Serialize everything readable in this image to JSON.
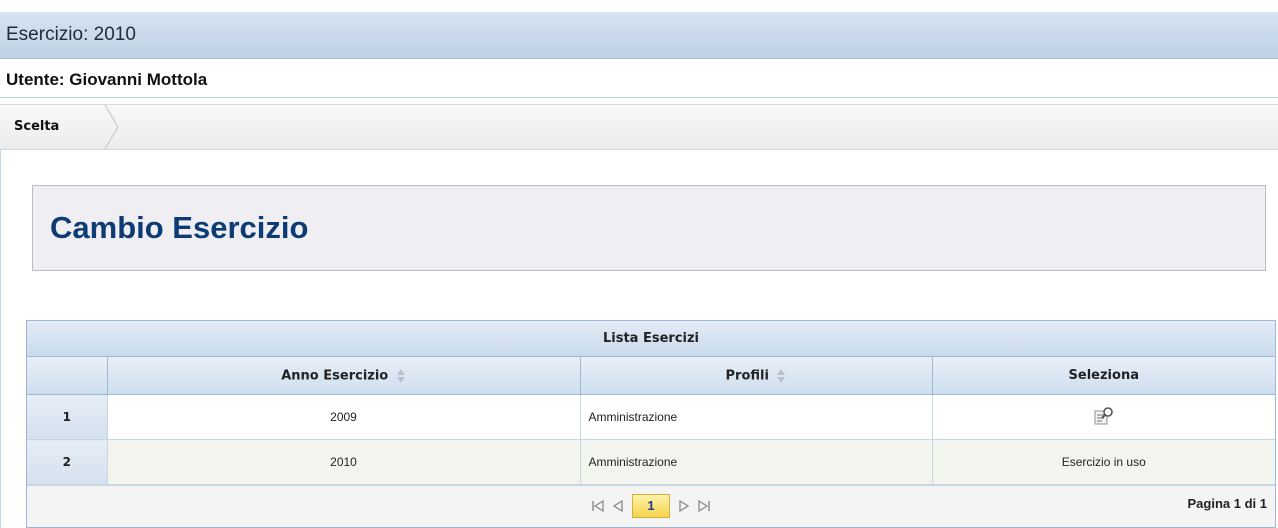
{
  "header": {
    "esercizio": "Esercizio: 2010",
    "utente": "Utente: Giovanni Mottola"
  },
  "breadcrumb": {
    "items": [
      "Scelta"
    ]
  },
  "page": {
    "title": "Cambio Esercizio"
  },
  "grid": {
    "caption": "Lista Esercizi",
    "columns": [
      "",
      "Anno Esercizio",
      "Profili",
      "Seleziona"
    ],
    "rows": [
      {
        "num": "1",
        "anno": "2009",
        "profili": "Amministrazione",
        "seleziona": "select-icon"
      },
      {
        "num": "2",
        "anno": "2010",
        "profili": "Amministrazione",
        "seleziona": "Esercizio in uso"
      }
    ]
  },
  "pager": {
    "current_page": "1",
    "info": "Pagina 1 di 1"
  },
  "colors": {
    "title": "#0d3b73",
    "header_bar": "#c9daec",
    "current_page": "#f5d54f"
  }
}
